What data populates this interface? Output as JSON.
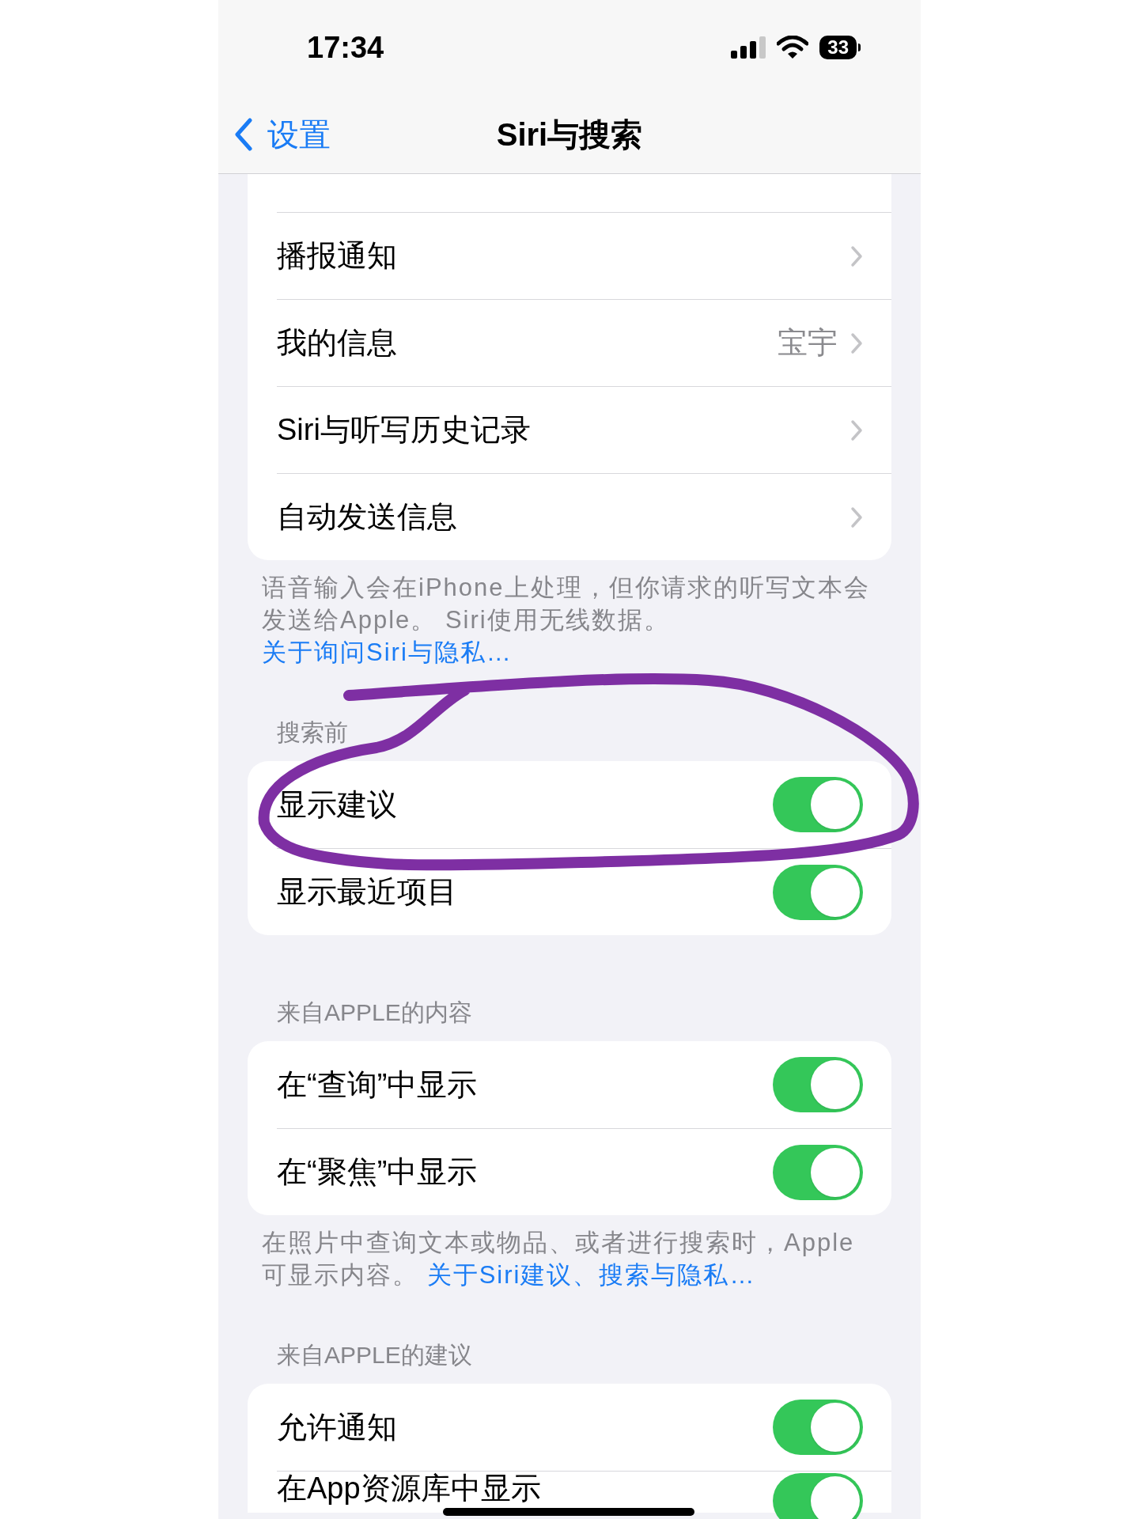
{
  "status_bar": {
    "time": "17:34",
    "battery": "33"
  },
  "nav": {
    "back": "设置",
    "title": "Siri与搜索"
  },
  "groups": [
    {
      "rows": [
        {
          "kind": "link",
          "label": "播报通知"
        },
        {
          "kind": "link",
          "label": "我的信息",
          "value": "宝宇"
        },
        {
          "kind": "link",
          "label": "Siri与听写历史记录"
        },
        {
          "kind": "link",
          "label": "自动发送信息"
        }
      ],
      "footer": {
        "text": "语音输入会在iPhone上处理，但你请求的听写文本会发送给Apple。 Siri使用无线数据。",
        "link": "关于询问Siri与隐私…"
      }
    },
    {
      "header": "搜索前",
      "rows": [
        {
          "kind": "toggle",
          "label": "显示建议",
          "on": true
        },
        {
          "kind": "toggle",
          "label": "显示最近项目",
          "on": true
        }
      ]
    },
    {
      "header": "来自APPLE的内容",
      "rows": [
        {
          "kind": "toggle",
          "label": "在“查询”中显示",
          "on": true
        },
        {
          "kind": "toggle",
          "label": "在“聚焦”中显示",
          "on": true
        }
      ],
      "footer": {
        "text": "在照片中查询文本或物品、或者进行搜索时，Apple可显示内容。",
        "link": "关于Siri建议、搜索与隐私…"
      }
    },
    {
      "header": "来自APPLE的建议",
      "rows": [
        {
          "kind": "toggle",
          "label": "允许通知",
          "on": true
        },
        {
          "kind": "toggle",
          "label": "在App资源库中显示",
          "on": true
        }
      ]
    }
  ]
}
